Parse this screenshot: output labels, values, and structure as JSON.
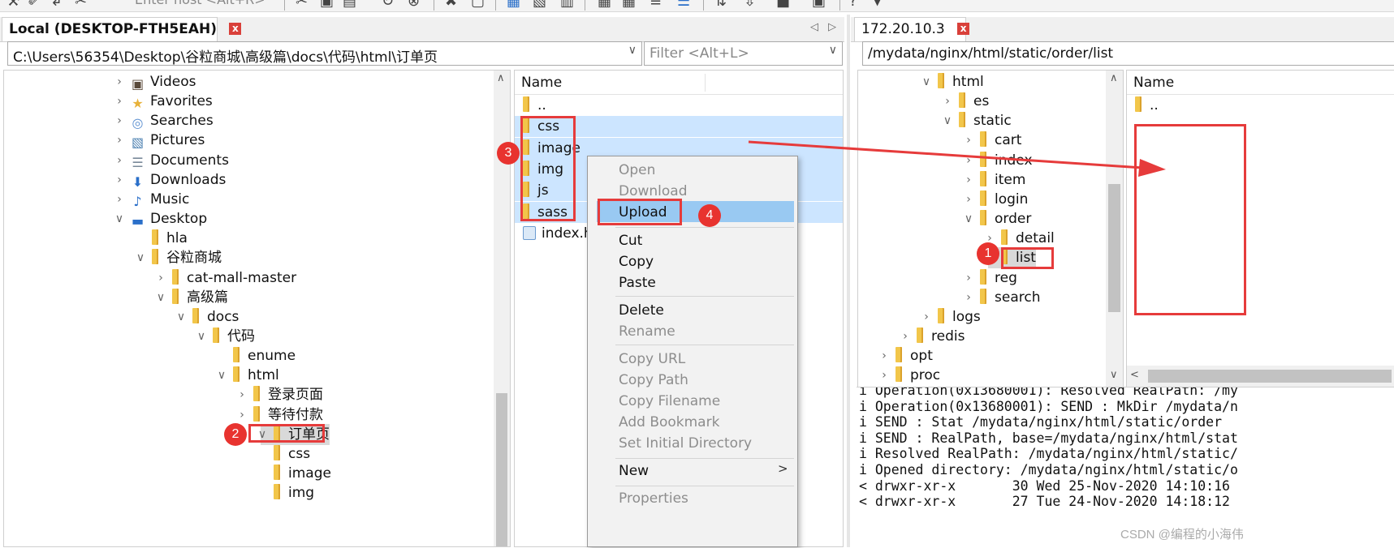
{
  "toolbar": {
    "host_hint": "Enter host <Alt+R>"
  },
  "colors": {
    "selection": "#cce5ff",
    "menu_highlight": "#99c9f2",
    "annotation_red": "#e63b3b",
    "folder": "#f2c64a",
    "tab_close": "#d9403a"
  },
  "left_panel": {
    "tab_label": "Local (DESKTOP-FTH5EAH)",
    "tab_close": "x",
    "path": "C:\\Users\\56354\\Desktop\\谷粒商城\\高级篇\\docs\\代码\\html\\订单页",
    "filter_placeholder": "Filter <Alt+L>",
    "tree": [
      {
        "label": "Videos",
        "icon": "video-icon",
        "chevron": ">"
      },
      {
        "label": "Favorites",
        "icon": "star-icon",
        "chevron": ">"
      },
      {
        "label": "Searches",
        "icon": "search-icon",
        "chevron": ">"
      },
      {
        "label": "Pictures",
        "icon": "picture-icon",
        "chevron": ">"
      },
      {
        "label": "Documents",
        "icon": "document-icon",
        "chevron": ">"
      },
      {
        "label": "Downloads",
        "icon": "download-icon",
        "chevron": ">"
      },
      {
        "label": "Music",
        "icon": "music-icon",
        "chevron": ">"
      },
      {
        "label": "Desktop",
        "icon": "desktop-icon",
        "chevron": "v"
      },
      {
        "label": "hla",
        "icon": "folder-icon",
        "chevron": ""
      },
      {
        "label": "谷粒商城",
        "icon": "folder-icon",
        "chevron": "v"
      },
      {
        "label": "cat-mall-master",
        "icon": "folder-icon",
        "chevron": ">"
      },
      {
        "label": "高级篇",
        "icon": "folder-icon",
        "chevron": "v"
      },
      {
        "label": "docs",
        "icon": "folder-icon",
        "chevron": "v"
      },
      {
        "label": "代码",
        "icon": "folder-icon",
        "chevron": "v"
      },
      {
        "label": "enume",
        "icon": "folder-icon",
        "chevron": ""
      },
      {
        "label": "html",
        "icon": "folder-icon",
        "chevron": "v"
      },
      {
        "label": "登录页面",
        "icon": "folder-icon",
        "chevron": ">"
      },
      {
        "label": "等待付款",
        "icon": "folder-icon",
        "chevron": ">"
      },
      {
        "label": "订单页",
        "icon": "folder-icon",
        "chevron": "v"
      },
      {
        "label": "css",
        "icon": "folder-icon",
        "chevron": ""
      },
      {
        "label": "image",
        "icon": "folder-icon",
        "chevron": ""
      },
      {
        "label": "img",
        "icon": "folder-icon",
        "chevron": ""
      }
    ],
    "files_header": "Name",
    "files": [
      {
        "label": ".."
      },
      {
        "label": "css"
      },
      {
        "label": "image"
      },
      {
        "label": "img"
      },
      {
        "label": "js"
      },
      {
        "label": "sass"
      },
      {
        "label": "index.h"
      }
    ]
  },
  "context_menu": {
    "items": [
      {
        "label": "Open",
        "disabled": true
      },
      {
        "label": "Download",
        "disabled": true
      },
      {
        "label": "Upload",
        "disabled": false
      },
      {
        "label": "Cut",
        "disabled": false
      },
      {
        "label": "Copy",
        "disabled": false
      },
      {
        "label": "Paste",
        "disabled": false
      },
      {
        "label": "Delete",
        "disabled": false
      },
      {
        "label": "Rename",
        "disabled": true
      },
      {
        "label": "Copy URL",
        "disabled": true
      },
      {
        "label": "Copy Path",
        "disabled": true
      },
      {
        "label": "Copy Filename",
        "disabled": true
      },
      {
        "label": "Add Bookmark",
        "disabled": true
      },
      {
        "label": "Set Initial Directory",
        "disabled": true
      },
      {
        "label": "New",
        "disabled": false
      },
      {
        "label": "Properties",
        "disabled": true
      }
    ],
    "submenu_arrow": ">"
  },
  "right_panel": {
    "tab_label": "172.20.10.3",
    "tab_close": "x",
    "path": "/mydata/nginx/html/static/order/list",
    "tree": [
      {
        "label": "html",
        "chevron": "v"
      },
      {
        "label": "es",
        "chevron": ">"
      },
      {
        "label": "static",
        "chevron": "v"
      },
      {
        "label": "cart",
        "chevron": ">"
      },
      {
        "label": "index",
        "chevron": ">"
      },
      {
        "label": "item",
        "chevron": ">"
      },
      {
        "label": "login",
        "chevron": ">"
      },
      {
        "label": "order",
        "chevron": "v"
      },
      {
        "label": "detail",
        "chevron": ">"
      },
      {
        "label": "list",
        "chevron": ""
      },
      {
        "label": "reg",
        "chevron": ">"
      },
      {
        "label": "search",
        "chevron": ">"
      },
      {
        "label": "logs",
        "chevron": ">"
      },
      {
        "label": "redis",
        "chevron": ">"
      },
      {
        "label": "opt",
        "chevron": ">"
      },
      {
        "label": "proc",
        "chevron": ">"
      }
    ],
    "files_header": "Name",
    "files": [
      {
        "label": ".."
      }
    ]
  },
  "log": [
    "i Operation(0x13680001): Resolved RealPath: /my",
    "i Operation(0x13680001): SEND : MkDir /mydata/n",
    "i SEND : Stat /mydata/nginx/html/static/order",
    "i SEND : RealPath, base=/mydata/nginx/html/stat",
    "i Resolved RealPath: /mydata/nginx/html/static/",
    "i Opened directory: /mydata/nginx/html/static/o",
    "< drwxr-xr-x       30 Wed 25-Nov-2020 14:10:16",
    "< drwxr-xr-x       27 Tue 24-Nov-2020 14:18:12"
  ],
  "watermark": "CSDN @编程的小海伟",
  "annotations": [
    "1",
    "2",
    "3",
    "4"
  ]
}
